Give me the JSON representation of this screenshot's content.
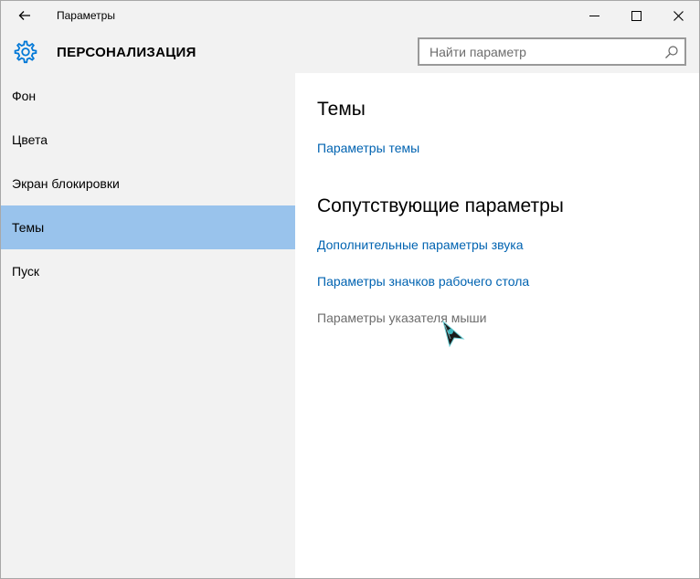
{
  "window": {
    "title": "Параметры",
    "controls": {
      "minimize_icon": "minimize-icon",
      "maximize_icon": "maximize-icon",
      "close_icon": "close-icon"
    }
  },
  "header": {
    "icon": "gear-icon",
    "title": "ПЕРСОНАЛИЗАЦИЯ",
    "search_placeholder": "Найти параметр",
    "search_value": ""
  },
  "sidebar": {
    "items": [
      {
        "label": "Фон",
        "selected": false
      },
      {
        "label": "Цвета",
        "selected": false
      },
      {
        "label": "Экран блокировки",
        "selected": false
      },
      {
        "label": "Темы",
        "selected": true
      },
      {
        "label": "Пуск",
        "selected": false
      }
    ]
  },
  "content": {
    "section1_title": "Темы",
    "theme_settings_link": "Параметры темы",
    "section2_title": "Сопутствующие параметры",
    "related_links": [
      {
        "label": "Дополнительные параметры звука",
        "state": "link"
      },
      {
        "label": "Параметры значков рабочего стола",
        "state": "link"
      },
      {
        "label": "Параметры указателя мыши",
        "state": "hover"
      }
    ]
  },
  "colors": {
    "accent": "#0078d7",
    "link": "#0063b1",
    "selected_nav": "#99c3ec",
    "sidebar_bg": "#f2f2f2",
    "content_bg": "#ffffff"
  }
}
